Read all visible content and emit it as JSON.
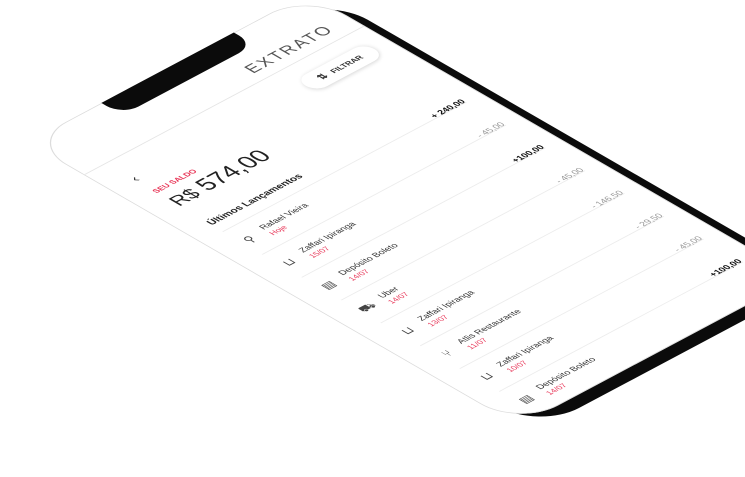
{
  "header": {
    "title": "EXTRATO",
    "back_symbol": "‹"
  },
  "filter": {
    "label": "FILTRAR",
    "icon": "sort-icon"
  },
  "balance": {
    "label": "SEU SALDO",
    "currency": "R$",
    "value": "574,00"
  },
  "section_title": "Últimos Lançamentos",
  "transactions": [
    {
      "amount": "+ 240,00",
      "positive": true,
      "name": "Rafael Vieira",
      "date": "Hoje",
      "icon": "user-icon"
    },
    {
      "amount": "- 45,00",
      "positive": false,
      "name": "Zaffari Ipiranga",
      "date": "15/07",
      "icon": "cart-icon"
    },
    {
      "amount": "+100,00",
      "positive": true,
      "name": "Depósito Boleto",
      "date": "14/07",
      "icon": "boleto-icon"
    },
    {
      "amount": "- 45,00",
      "positive": false,
      "name": "Uber",
      "date": "14/07",
      "icon": "car-icon"
    },
    {
      "amount": "- 146,50",
      "positive": false,
      "name": "Zaffari Ipiranga",
      "date": "13/07",
      "icon": "cart-icon"
    },
    {
      "amount": "- 29,50",
      "positive": false,
      "name": "Atlis Restaurante",
      "date": "11/07",
      "icon": "restaurant-icon"
    },
    {
      "amount": "- 45,00",
      "positive": false,
      "name": "Zaffari Ipiranga",
      "date": "10/07",
      "icon": "cart-icon"
    },
    {
      "amount": "+100,00",
      "positive": true,
      "name": "Depósito Boleto",
      "date": "14/07",
      "icon": "boleto-icon"
    }
  ]
}
